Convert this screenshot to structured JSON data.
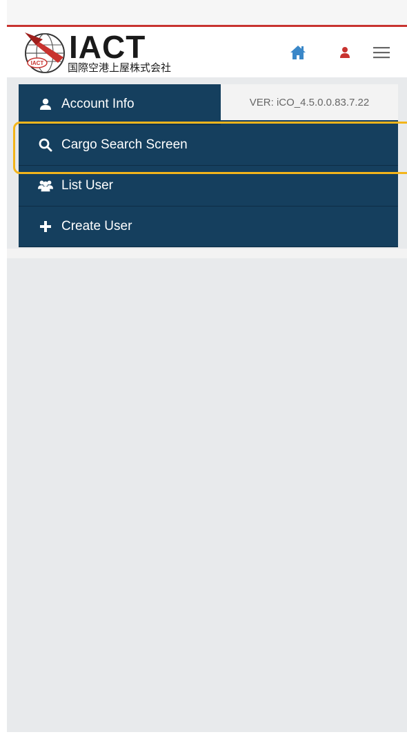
{
  "header": {
    "logo_title": "IACT",
    "logo_subtitle": "国際空港上屋株式会社",
    "logo_badge": "IACT",
    "home_icon": "home-icon",
    "user_icon": "user-icon",
    "menu_icon": "hamburger-menu-icon"
  },
  "version": "VER: iCO_4.5.0.0.83.7.22",
  "menu": {
    "items": [
      {
        "label": "Account Info",
        "icon": "user-icon"
      },
      {
        "label": "Cargo Search Screen",
        "icon": "search-icon"
      },
      {
        "label": "List User",
        "icon": "users-icon"
      },
      {
        "label": "Create User",
        "icon": "plus-icon"
      }
    ]
  },
  "colors": {
    "menu_bg": "#153f5e",
    "accent_red": "#c8332f",
    "home_blue": "#3a87c8",
    "highlight": "#f3b51b"
  }
}
